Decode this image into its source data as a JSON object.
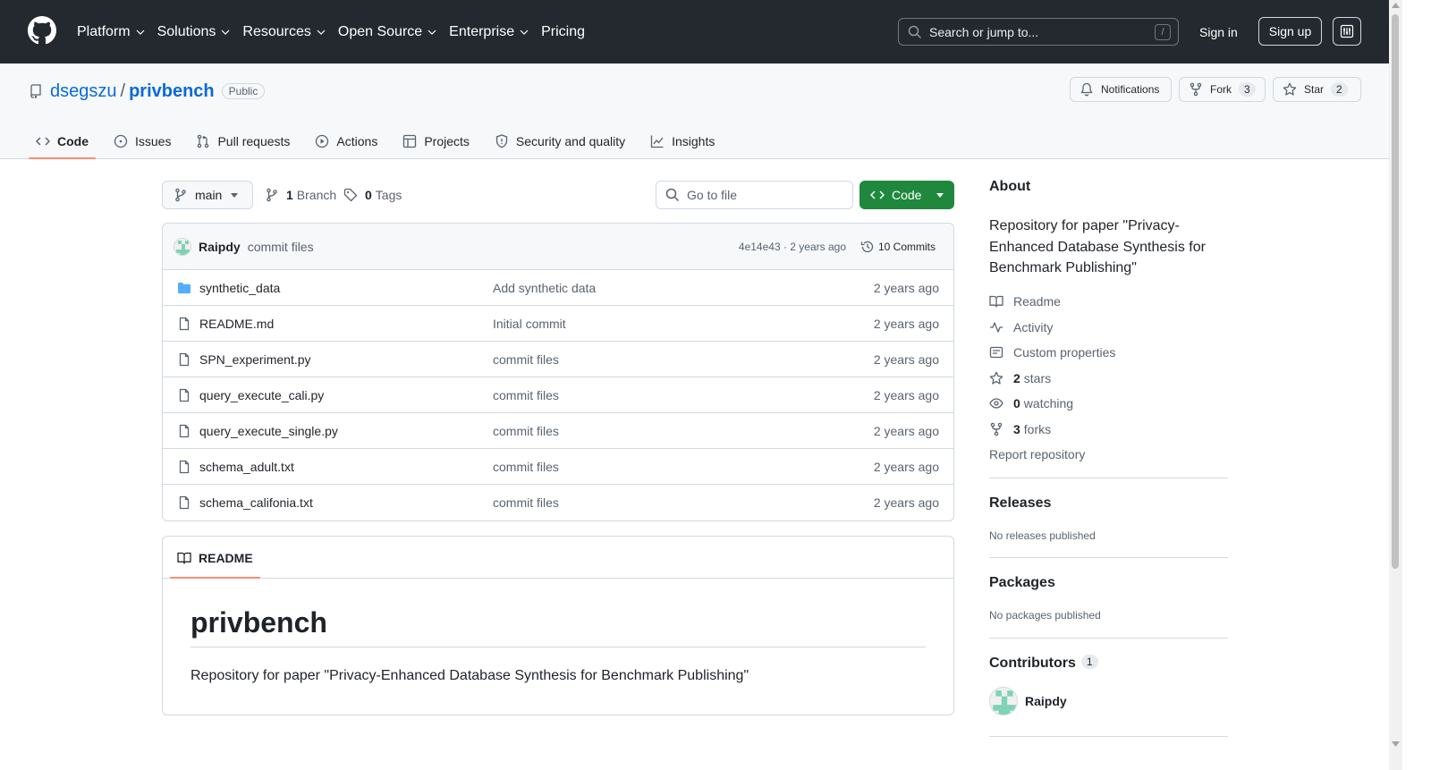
{
  "topnav": {
    "items": [
      {
        "label": "Platform",
        "chevron": true
      },
      {
        "label": "Solutions",
        "chevron": true
      },
      {
        "label": "Resources",
        "chevron": true
      },
      {
        "label": "Open Source",
        "chevron": true
      },
      {
        "label": "Enterprise",
        "chevron": true
      },
      {
        "label": "Pricing",
        "chevron": false
      }
    ],
    "search_placeholder": "Search or jump to...",
    "search_key": "/",
    "signin": "Sign in",
    "signup": "Sign up"
  },
  "repo": {
    "owner": "dsegszu",
    "separator": "/",
    "name": "privbench",
    "visibility": "Public",
    "notifications_label": "Notifications",
    "fork_label": "Fork",
    "fork_count": "3",
    "star_label": "Star",
    "star_count": "2"
  },
  "tabs": [
    {
      "label": "Code",
      "icon": "code-icon",
      "active": true
    },
    {
      "label": "Issues",
      "icon": "issue-icon"
    },
    {
      "label": "Pull requests",
      "icon": "pull-request-icon"
    },
    {
      "label": "Actions",
      "icon": "play-icon"
    },
    {
      "label": "Projects",
      "icon": "table-icon"
    },
    {
      "label": "Security and quality",
      "icon": "shield-icon"
    },
    {
      "label": "Insights",
      "icon": "graph-icon"
    }
  ],
  "toolbar": {
    "branch": "main",
    "branch_count": "1",
    "branch_label": "Branch",
    "tag_count": "0",
    "tag_label": "Tags",
    "goto_placeholder": "Go to file",
    "code_label": "Code"
  },
  "commit": {
    "author": "Raipdy",
    "message": "commit files",
    "hash_and_time": "4e14e43 · 2 years ago",
    "commits_label": "10 Commits"
  },
  "files": [
    {
      "name": "synthetic_data",
      "type": "folder",
      "message": "Add synthetic data",
      "date": "2 years ago"
    },
    {
      "name": "README.md",
      "type": "file",
      "message": "Initial commit",
      "date": "2 years ago"
    },
    {
      "name": "SPN_experiment.py",
      "type": "file",
      "message": "commit files",
      "date": "2 years ago"
    },
    {
      "name": "query_execute_cali.py",
      "type": "file",
      "message": "commit files",
      "date": "2 years ago"
    },
    {
      "name": "query_execute_single.py",
      "type": "file",
      "message": "commit files",
      "date": "2 years ago"
    },
    {
      "name": "schema_adult.txt",
      "type": "file",
      "message": "commit files",
      "date": "2 years ago"
    },
    {
      "name": "schema_califonia.txt",
      "type": "file",
      "message": "commit files",
      "date": "2 years ago"
    }
  ],
  "readme": {
    "tab_label": "README",
    "heading": "privbench",
    "body": "Repository for paper \"Privacy-Enhanced Database Synthesis for Benchmark Publishing\""
  },
  "about": {
    "heading": "About",
    "description": "Repository for paper \"Privacy-Enhanced Database Synthesis for Benchmark Publishing\"",
    "readme": "Readme",
    "activity": "Activity",
    "custom_properties": "Custom properties",
    "stars_count": "2",
    "stars_label": "stars",
    "watching_count": "0",
    "watching_label": "watching",
    "forks_count": "3",
    "forks_label": "forks",
    "report": "Report repository"
  },
  "releases": {
    "heading": "Releases",
    "empty": "No releases published"
  },
  "packages": {
    "heading": "Packages",
    "empty": "No packages published"
  },
  "contributors": {
    "heading": "Contributors",
    "count": "1",
    "name": "Raipdy"
  },
  "colors": {
    "header_bg": "#24292f",
    "link": "#0969da",
    "primary_button": "#1f883d",
    "active_tab_underline": "#fd8c73",
    "folder_icon": "#54aeff"
  }
}
